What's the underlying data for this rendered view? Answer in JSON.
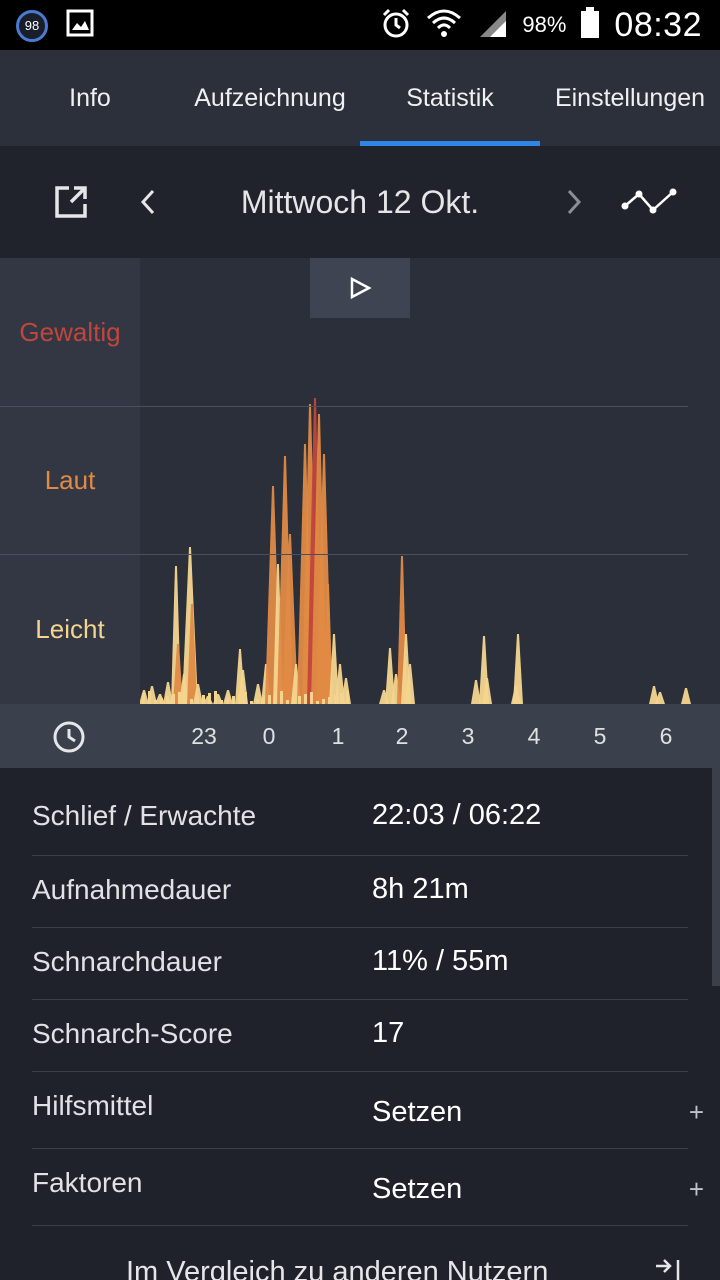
{
  "status_bar": {
    "notification_badge": "98",
    "battery_percent": "98%",
    "time": "08:32",
    "icons": [
      "image-icon",
      "alarm-icon",
      "wifi-icon",
      "signal-icon",
      "battery-icon"
    ]
  },
  "tabs": [
    {
      "label": "Info",
      "active": false
    },
    {
      "label": "Aufzeichnung",
      "active": false
    },
    {
      "label": "Statistik",
      "active": true
    },
    {
      "label": "Einstellungen",
      "active": false
    }
  ],
  "date_bar": {
    "title": "Mittwoch 12 Okt.",
    "icons": [
      "share-icon",
      "chevron-left-icon",
      "chevron-right-icon",
      "trend-icon"
    ]
  },
  "chart_data": {
    "type": "area",
    "y_categories": [
      "Gewaltig",
      "Laut",
      "Leicht"
    ],
    "x_ticks": [
      "23",
      "0",
      "1",
      "2",
      "3",
      "4",
      "5",
      "6"
    ],
    "colors": {
      "gewaltig": "#c0463c",
      "laut": "#e08a45",
      "leicht": "#f4d58f"
    }
  },
  "stats": {
    "rows": [
      {
        "label": "Schlief / Erwachte",
        "value": "22:03 / 06:22"
      },
      {
        "label": "Aufnahmedauer",
        "value": "8h 21m"
      },
      {
        "label": "Schnarchdauer",
        "value": "11% / 55m"
      },
      {
        "label": "Schnarch-Score",
        "value": "17"
      },
      {
        "label": "Hilfsmittel",
        "value": "Setzen",
        "action": "+"
      },
      {
        "label": "Faktoren",
        "value": "Setzen",
        "action": "+"
      }
    ],
    "compare_label": "Im Vergleich zu anderen Nutzern"
  },
  "colors": {
    "accent": "#2f86e8",
    "background": "#1f222b",
    "panel": "#2b303b"
  }
}
